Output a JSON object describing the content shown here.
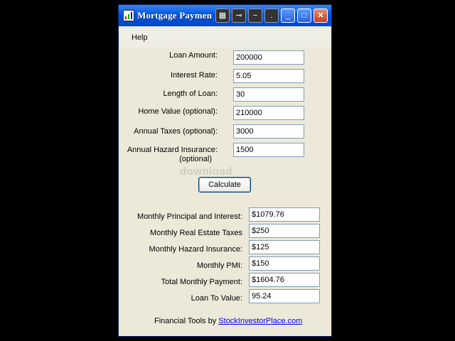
{
  "window": {
    "title": "Mortgage Paymen",
    "menu": [
      "Help"
    ]
  },
  "inputs": [
    {
      "label": "Loan Amount:",
      "value": "200000"
    },
    {
      "label": "Interest Rate:",
      "value": "5.05"
    },
    {
      "label": "Length of Loan:",
      "value": "30"
    },
    {
      "label": "Home Value (optional):",
      "value": "210000"
    },
    {
      "label": "Annual Taxes (optional):",
      "value": "3000"
    },
    {
      "label": "Annual Hazard Insurance:",
      "label2": "(optional)",
      "value": "1500"
    }
  ],
  "calculate_label": "Calculate",
  "watermark": "download",
  "results": [
    {
      "label": "Monthly Principal and Interest:",
      "value": "$1079.76"
    },
    {
      "label": "Monthly Real Estate Taxes",
      "value": "$250"
    },
    {
      "label": "Monthly Hazard Insurance:",
      "value": "$125"
    },
    {
      "label": "Monthly PMI:",
      "value": "$150"
    },
    {
      "label": "Total Monthly Payment:",
      "value": "$1604.76"
    },
    {
      "label": "Loan To Value:",
      "value": "95.24"
    }
  ],
  "footer": {
    "text": "Financial Tools by ",
    "link": "StockInvestorPlace.com"
  },
  "colors": {
    "titlebar": "#0054E3",
    "window_bg": "#ECE9D8",
    "close": "#C4411F"
  }
}
